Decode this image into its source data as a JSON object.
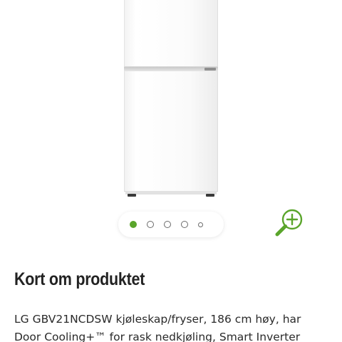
{
  "product": {
    "image_alt": "LG GBV21NCDSW kjøleskap/fryser",
    "carousel": {
      "total_images": 5,
      "active_index": 1
    },
    "zoom_icon": "zoom-in-icon"
  },
  "section": {
    "heading": "Kort om produktet",
    "description_lines": [
      "LG GBV21NCDSW kjøleskap/fryser, 186 cm høy, har",
      "Door Cooling+™ for rask nedkjøling, Smart Inverter"
    ]
  },
  "colors": {
    "accent_green": "#5aa52b",
    "text": "#222222"
  }
}
